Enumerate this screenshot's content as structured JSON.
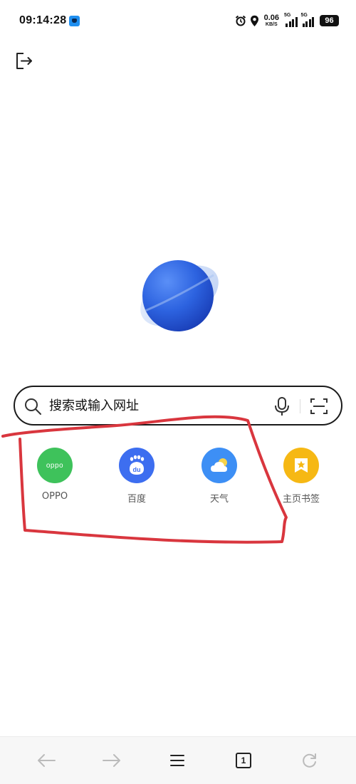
{
  "status_bar": {
    "time": "09:14:28",
    "net_speed_value": "0.06",
    "net_speed_unit": "KB/S",
    "sim1_tag": "5G",
    "sim2_tag": "5G",
    "battery": "96",
    "icons": [
      "app-notification-icon",
      "alarm-icon",
      "location-icon",
      "signal-icon",
      "battery-icon"
    ]
  },
  "header": {
    "exit_icon": "exit-icon"
  },
  "logo": {
    "icon": "planet-logo"
  },
  "search": {
    "placeholder": "搜索或输入网址",
    "icons": [
      "search-icon",
      "mic-icon",
      "scan-icon"
    ]
  },
  "shortcuts": [
    {
      "label": "OPPO",
      "icon_text": "oppo",
      "color": "#3ec25b"
    },
    {
      "label": "百度",
      "icon_text": "du",
      "color": "#3d6ef0"
    },
    {
      "label": "天气",
      "icon": "weather-icon",
      "color": "#3d8ff5"
    },
    {
      "label": "主页书签",
      "icon": "bookmark-star-icon",
      "color": "#f6b814"
    }
  ],
  "bottom_nav": {
    "tab_count": "1",
    "icons": [
      "back-arrow-icon",
      "forward-arrow-icon",
      "menu-icon",
      "tabs-icon",
      "refresh-icon"
    ]
  },
  "colors": {
    "annotation": "#d9363e",
    "accent_blue": "#2d63e0"
  }
}
